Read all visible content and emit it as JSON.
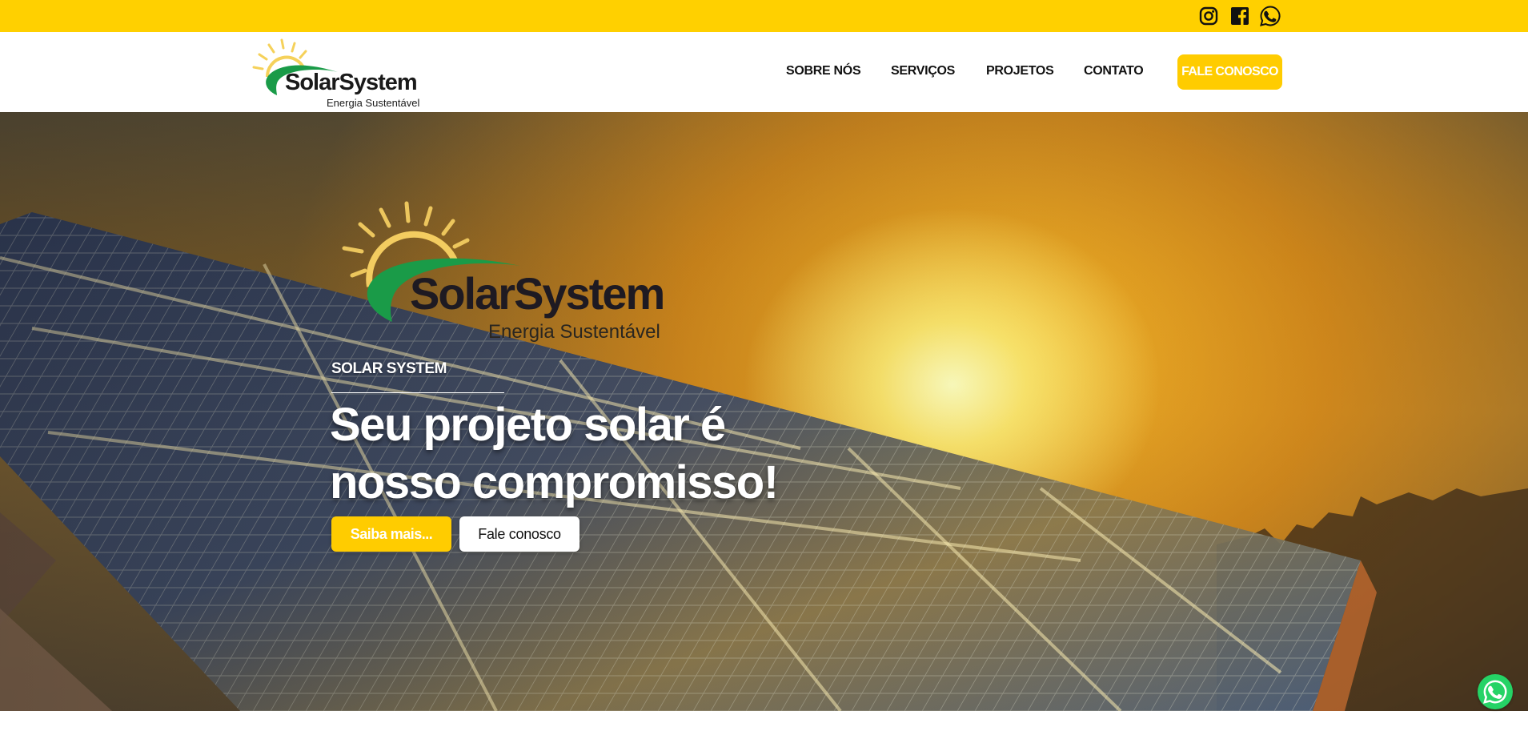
{
  "colors": {
    "accent": "#ffcc00",
    "topbar": "#ffd000",
    "logo_green": "#1a9b48",
    "logo_text": "#1a1a1a",
    "whatsapp": "#25d366"
  },
  "social": {
    "instagram_icon": "instagram-icon",
    "facebook_icon": "facebook-icon",
    "whatsapp_icon": "whatsapp-icon"
  },
  "brand": {
    "name_part1": "Solar",
    "name_part2": "System",
    "tagline": "Energia Sustentável"
  },
  "nav": {
    "items": [
      {
        "label": "SOBRE NÓS"
      },
      {
        "label": "SERVIÇOS"
      },
      {
        "label": "PROJETOS"
      },
      {
        "label": "CONTATO"
      }
    ],
    "cta": "FALE CONOSCO"
  },
  "hero": {
    "eyebrow": "SOLAR SYSTEM",
    "headline_line1": "Seu projeto solar é",
    "headline_line2": "nosso compromisso!",
    "primary_button": "Saiba mais...",
    "secondary_button": "Fale conosco"
  },
  "floating": {
    "whatsapp_icon": "whatsapp-icon"
  }
}
